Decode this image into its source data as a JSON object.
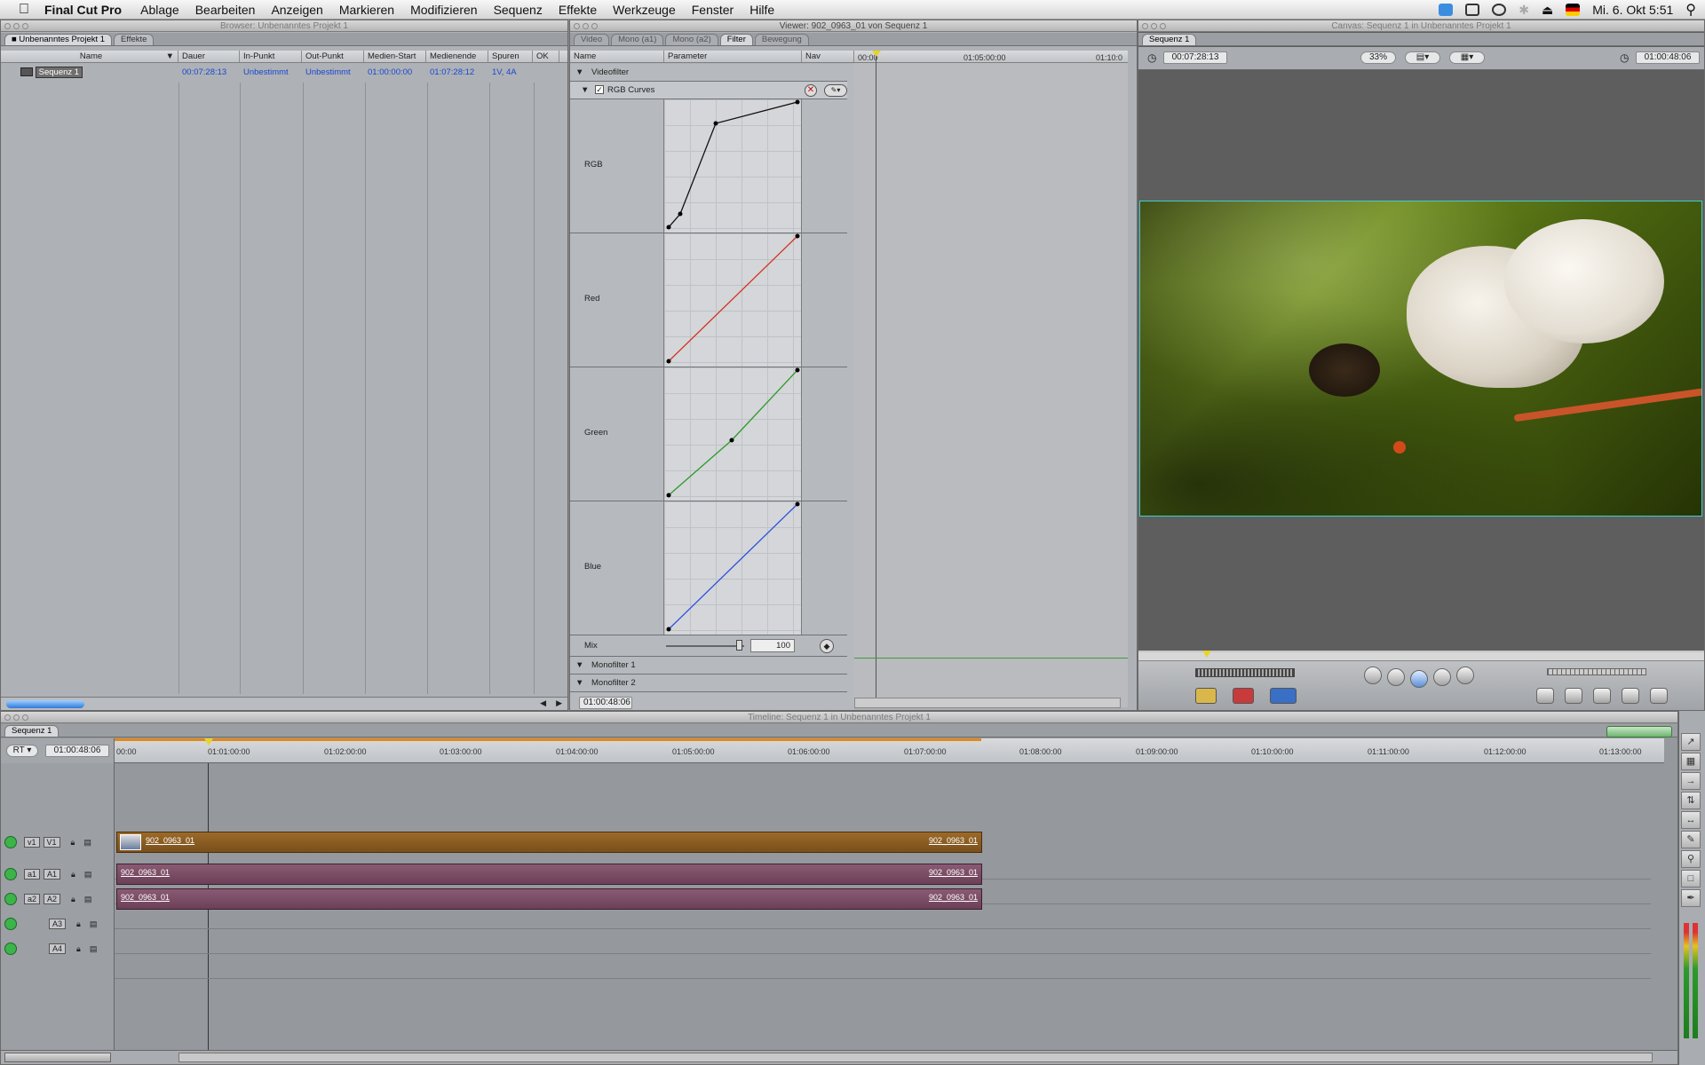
{
  "menubar": {
    "app_name": "Final Cut Pro",
    "items": [
      "Ablage",
      "Bearbeiten",
      "Anzeigen",
      "Markieren",
      "Modifizieren",
      "Sequenz",
      "Effekte",
      "Werkzeuge",
      "Fenster",
      "Hilfe"
    ],
    "clock": "Mi. 6. Okt  5:51"
  },
  "browser": {
    "title": "Browser: Unbenanntes Projekt 1",
    "tabs": [
      "Unbenanntes Projekt 1",
      "Effekte"
    ],
    "columns": [
      "Name",
      "Dauer",
      "In-Punkt",
      "Out-Punkt",
      "Medien-Start",
      "Medienende",
      "Spuren",
      "OK"
    ],
    "rows": [
      {
        "name": "Sequenz 1",
        "dauer": "00:07:28:13",
        "in": "Unbestimmt",
        "out": "Unbestimmt",
        "start": "01:00:00:00",
        "end": "01:07:28:12",
        "spuren": "1V, 4A"
      }
    ]
  },
  "viewer": {
    "title": "Viewer: 902_0963_01 von Sequenz 1",
    "tabs": [
      "Video",
      "Mono (a1)",
      "Mono (a2)",
      "Filter",
      "Bewegung"
    ],
    "col_name": "Name",
    "col_param": "Parameter",
    "col_nav": "Nav",
    "ruler": [
      "00:00",
      "01:05:00:00",
      "01:10:0"
    ],
    "videofilter": "Videofilter",
    "filter_name": "RGB Curves",
    "curves": [
      "RGB",
      "Red",
      "Green",
      "Blue"
    ],
    "mix_label": "Mix",
    "mix_value": "100",
    "monofilter1": "Monofilter 1",
    "monofilter2": "Monofilter 2",
    "timecode": "01:00:48:06"
  },
  "canvas": {
    "title": "Canvas: Sequenz 1 in Unbenanntes Projekt 1",
    "tab": "Sequenz 1",
    "duration": "00:07:28:13",
    "zoom": "33%",
    "current_tc": "01:00:48:06"
  },
  "timeline": {
    "title": "Timeline: Sequenz 1 in Unbenanntes Projekt 1",
    "tab": "Sequenz 1",
    "rt": "RT",
    "current_tc": "01:00:48:06",
    "ruler": [
      "00:00",
      "01:01:00:00",
      "01:02:00:00",
      "01:03:00:00",
      "01:04:00:00",
      "01:05:00:00",
      "01:06:00:00",
      "01:07:00:00",
      "01:08:00:00",
      "01:09:00:00",
      "01:10:00:00",
      "01:11:00:00",
      "01:12:00:00",
      "01:13:00:00"
    ],
    "tracks": {
      "v1_src": "v1",
      "v1_dst": "V1",
      "a1_src": "a1",
      "a1_dst": "A1",
      "a2_src": "a2",
      "a2_dst": "A2",
      "a3_dst": "A3",
      "a4_dst": "A4"
    },
    "clip_name": "902_0963_01"
  }
}
